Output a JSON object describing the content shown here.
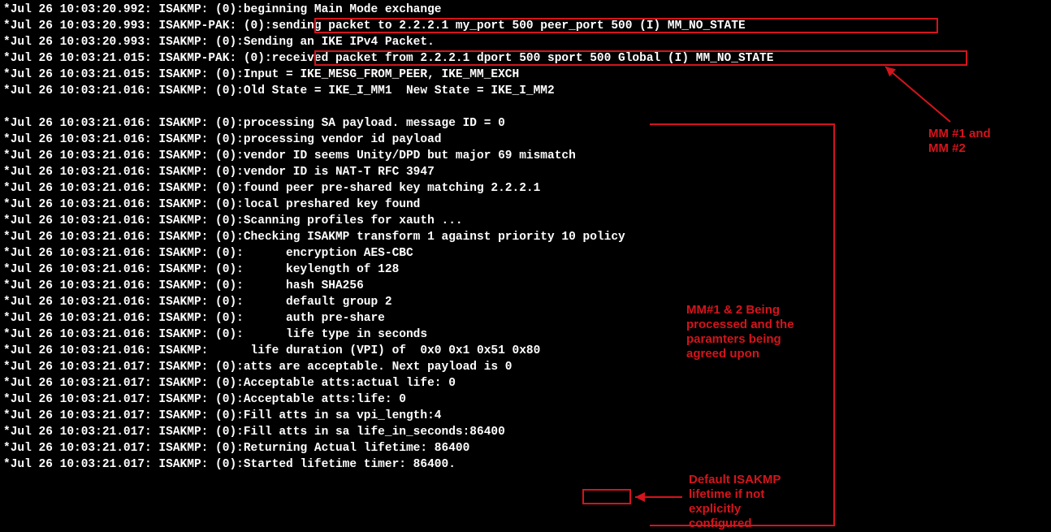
{
  "log": {
    "lines": [
      "*Jul 26 10:03:20.992: ISAKMP: (0):beginning Main Mode exchange",
      "*Jul 26 10:03:20.993: ISAKMP-PAK: (0):sending packet to 2.2.2.1 my_port 500 peer_port 500 (I) MM_NO_STATE",
      "*Jul 26 10:03:20.993: ISAKMP: (0):Sending an IKE IPv4 Packet.",
      "*Jul 26 10:03:21.015: ISAKMP-PAK: (0):received packet from 2.2.2.1 dport 500 sport 500 Global (I) MM_NO_STATE",
      "*Jul 26 10:03:21.015: ISAKMP: (0):Input = IKE_MESG_FROM_PEER, IKE_MM_EXCH",
      "*Jul 26 10:03:21.016: ISAKMP: (0):Old State = IKE_I_MM1  New State = IKE_I_MM2",
      "",
      "*Jul 26 10:03:21.016: ISAKMP: (0):processing SA payload. message ID = 0",
      "*Jul 26 10:03:21.016: ISAKMP: (0):processing vendor id payload",
      "*Jul 26 10:03:21.016: ISAKMP: (0):vendor ID seems Unity/DPD but major 69 mismatch",
      "*Jul 26 10:03:21.016: ISAKMP: (0):vendor ID is NAT-T RFC 3947",
      "*Jul 26 10:03:21.016: ISAKMP: (0):found peer pre-shared key matching 2.2.2.1",
      "*Jul 26 10:03:21.016: ISAKMP: (0):local preshared key found",
      "*Jul 26 10:03:21.016: ISAKMP: (0):Scanning profiles for xauth ...",
      "*Jul 26 10:03:21.016: ISAKMP: (0):Checking ISAKMP transform 1 against priority 10 policy",
      "*Jul 26 10:03:21.016: ISAKMP: (0):      encryption AES-CBC",
      "*Jul 26 10:03:21.016: ISAKMP: (0):      keylength of 128",
      "*Jul 26 10:03:21.016: ISAKMP: (0):      hash SHA256",
      "*Jul 26 10:03:21.016: ISAKMP: (0):      default group 2",
      "*Jul 26 10:03:21.016: ISAKMP: (0):      auth pre-share",
      "*Jul 26 10:03:21.016: ISAKMP: (0):      life type in seconds",
      "*Jul 26 10:03:21.016: ISAKMP:      life duration (VPI) of  0x0 0x1 0x51 0x80",
      "*Jul 26 10:03:21.017: ISAKMP: (0):atts are acceptable. Next payload is 0",
      "*Jul 26 10:03:21.017: ISAKMP: (0):Acceptable atts:actual life: 0",
      "*Jul 26 10:03:21.017: ISAKMP: (0):Acceptable atts:life: 0",
      "*Jul 26 10:03:21.017: ISAKMP: (0):Fill atts in sa vpi_length:4",
      "*Jul 26 10:03:21.017: ISAKMP: (0):Fill atts in sa life_in_seconds:86400",
      "*Jul 26 10:03:21.017: ISAKMP: (0):Returning Actual lifetime: 86400",
      "*Jul 26 10:03:21.017: ISAKMP: (0):Started lifetime timer: 86400."
    ]
  },
  "annotations": {
    "mm12": "MM #1 and\nMM #2",
    "processed": "MM#1 & 2 Being\nprocessed and the\nparamters being\nagreed upon",
    "lifetime": "Default ISAKMP\nlifetime if not\nexplicitly\nconfigured"
  }
}
